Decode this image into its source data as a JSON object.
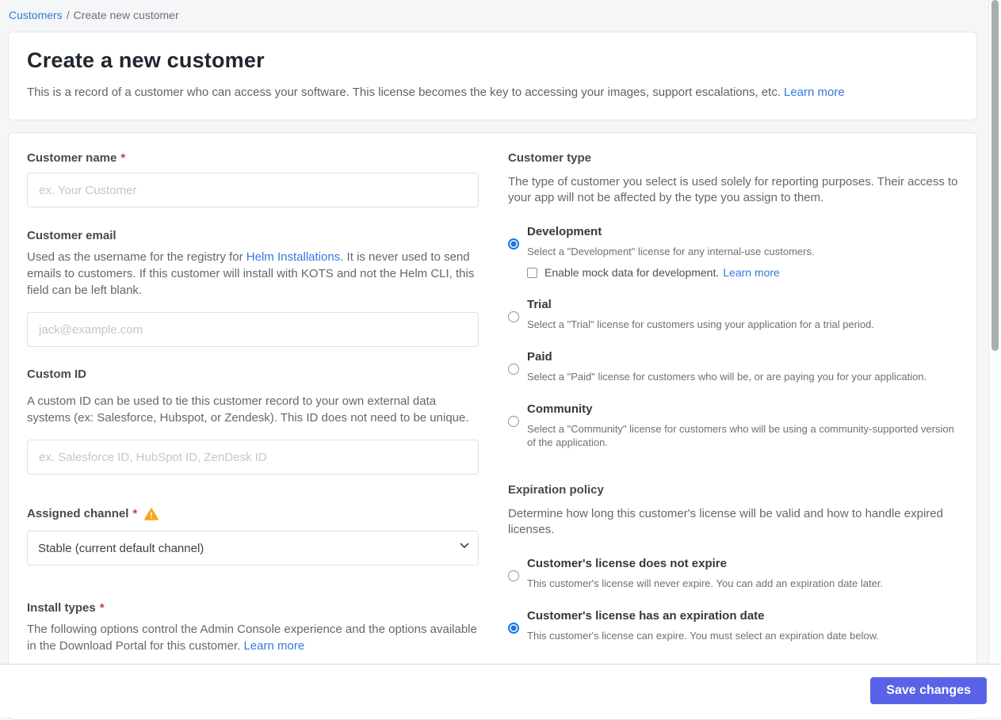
{
  "breadcrumb": {
    "link": "Customers",
    "separator": "/",
    "current": "Create new customer"
  },
  "header": {
    "title": "Create a new customer",
    "description": "This is a record of a customer who can access your software. This license becomes the key to accessing your images, support escalations, etc.",
    "learn_more": "Learn more"
  },
  "form": {
    "customer_name": {
      "label": "Customer name",
      "required": "*",
      "placeholder": "ex. Your Customer",
      "value": ""
    },
    "customer_email": {
      "label": "Customer email",
      "description_before": "Used as the username for the registry for ",
      "link": "Helm Installations",
      "description_after": ". It is never used to send emails to customers. If this customer will install with KOTS and not the Helm CLI, this field can be left blank.",
      "placeholder": "jack@example.com",
      "value": ""
    },
    "custom_id": {
      "label": "Custom ID",
      "description": "A custom ID can be used to tie this customer record to your own external data systems (ex: Salesforce, Hubspot, or Zendesk). This ID does not need to be unique.",
      "placeholder": "ex. Salesforce ID, HubSpot ID, ZenDesk ID",
      "value": ""
    },
    "assigned_channel": {
      "label": "Assigned channel",
      "required": "*",
      "selected_option": "Stable (current default channel)"
    },
    "install_types": {
      "label": "Install types",
      "required": "*",
      "description": "The following options control the Admin Console experience and the options available in the Download Portal for this customer.",
      "learn_more": "Learn more"
    }
  },
  "customer_type": {
    "heading": "Customer type",
    "description": "The type of customer you select is used solely for reporting purposes. Their access to your app will not be affected by the type you assign to them.",
    "options": [
      {
        "title": "Development",
        "description": "Select a \"Development\" license for any internal-use customers.",
        "selected": true,
        "extra": {
          "checkbox_label": "Enable mock data for development.",
          "learn_more": "Learn more",
          "checked": false
        }
      },
      {
        "title": "Trial",
        "description": "Select a \"Trial\" license for customers using your application for a trial period.",
        "selected": false
      },
      {
        "title": "Paid",
        "description": "Select a \"Paid\" license for customers who will be, or are paying you for your application.",
        "selected": false
      },
      {
        "title": "Community",
        "description": "Select a \"Community\" license for customers who will be using a community-supported version of the application.",
        "selected": false
      }
    ]
  },
  "expiration_policy": {
    "heading": "Expiration policy",
    "description": "Determine how long this customer's license will be valid and how to handle expired licenses.",
    "options": [
      {
        "title": "Customer's license does not expire",
        "description": "This customer's license will never expire. You can add an expiration date later.",
        "selected": false
      },
      {
        "title": "Customer's license has an expiration date",
        "description": "This customer's license can expire. You must select an expiration date below.",
        "selected": true
      }
    ]
  },
  "footer": {
    "save_label": "Save changes"
  },
  "colors": {
    "link_blue": "#3478e0",
    "button_indigo": "#5a62e8",
    "radio_selected_blue": "#1776e8",
    "warning_amber": "#f8a61c",
    "required_red": "#cc4036",
    "page_background": "#f5f6f8"
  }
}
